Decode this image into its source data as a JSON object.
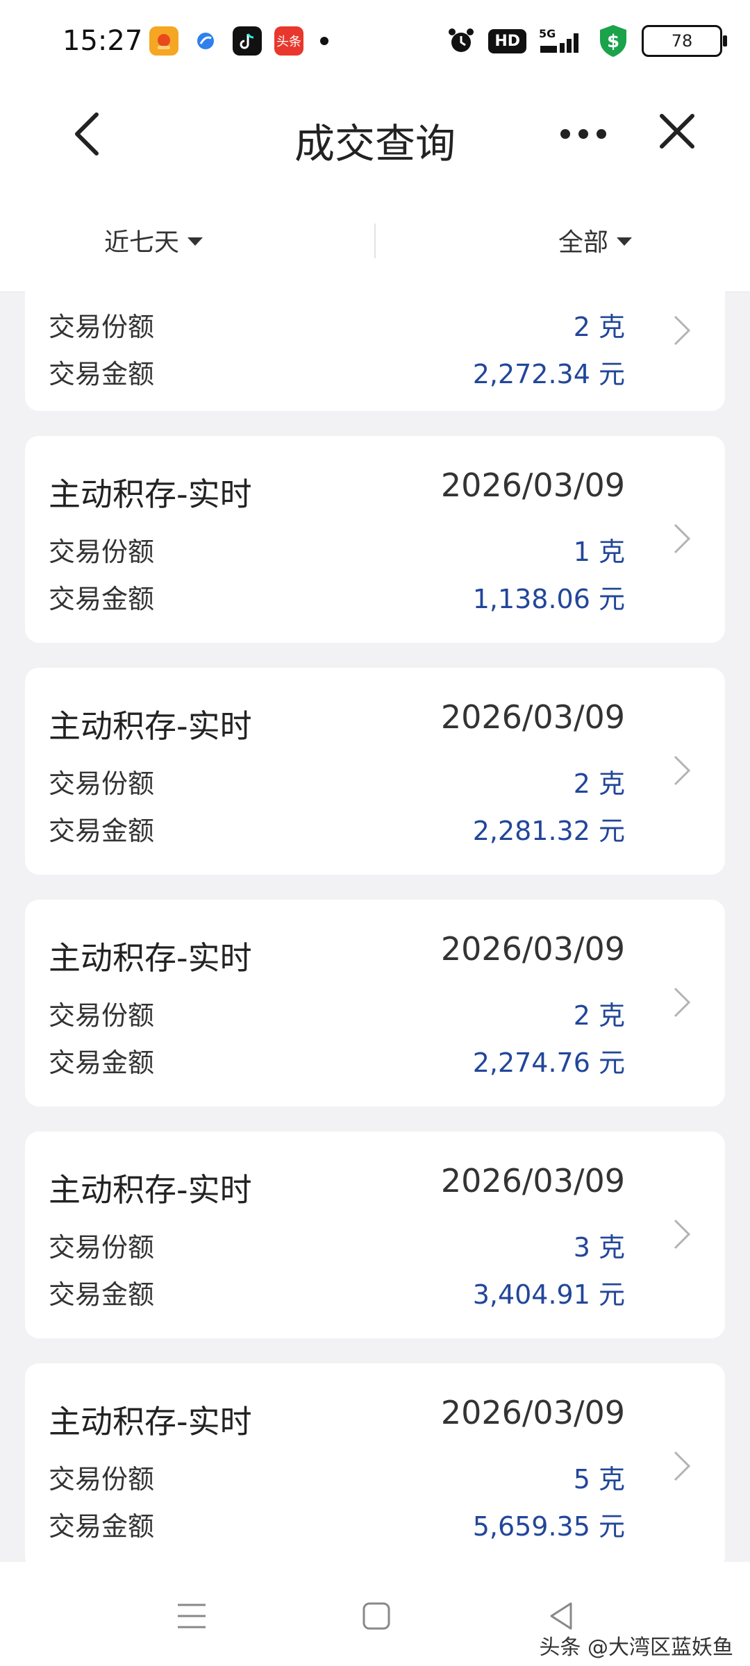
{
  "status_bar": {
    "time": "15:27",
    "app_icons": [
      "weather-app-icon",
      "browser-app-icon",
      "tiktok-app-icon",
      "toutiao-app-icon"
    ],
    "toutiao_label": "头条",
    "network": "5G",
    "hd_label": "HD",
    "battery": "78"
  },
  "header": {
    "title": "成交查询",
    "back_icon": "chevron-left-icon",
    "more_icon": "more-icon",
    "close_icon": "close-icon"
  },
  "filters": {
    "period": "近七天",
    "type": "全部"
  },
  "list": {
    "partial_card": {
      "share_label": "交易份额",
      "share_value": "2 克",
      "amount_label": "交易金额",
      "amount_value": "2,272.34 元"
    },
    "cards": [
      {
        "title": "主动积存-实时",
        "date": "2026/03/09",
        "share_label": "交易份额",
        "share_value": "1 克",
        "amount_label": "交易金额",
        "amount_value": "1,138.06 元"
      },
      {
        "title": "主动积存-实时",
        "date": "2026/03/09",
        "share_label": "交易份额",
        "share_value": "2 克",
        "amount_label": "交易金额",
        "amount_value": "2,281.32 元"
      },
      {
        "title": "主动积存-实时",
        "date": "2026/03/09",
        "share_label": "交易份额",
        "share_value": "2 克",
        "amount_label": "交易金额",
        "amount_value": "2,274.76 元"
      },
      {
        "title": "主动积存-实时",
        "date": "2026/03/09",
        "share_label": "交易份额",
        "share_value": "3 克",
        "amount_label": "交易金额",
        "amount_value": "3,404.91 元"
      },
      {
        "title": "主动积存-实时",
        "date": "2026/03/09",
        "share_label": "交易份额",
        "share_value": "5 克",
        "amount_label": "交易金额",
        "amount_value": "5,659.35 元"
      }
    ]
  },
  "nav_bar": {
    "menu_icon": "menu-icon",
    "home_icon": "home-square-icon",
    "back_icon": "back-triangle-icon"
  },
  "watermark": "头条 @大湾区蓝妖鱼",
  "colors": {
    "value_blue": "#22469a",
    "background": "#f2f2f4",
    "card": "#ffffff"
  }
}
